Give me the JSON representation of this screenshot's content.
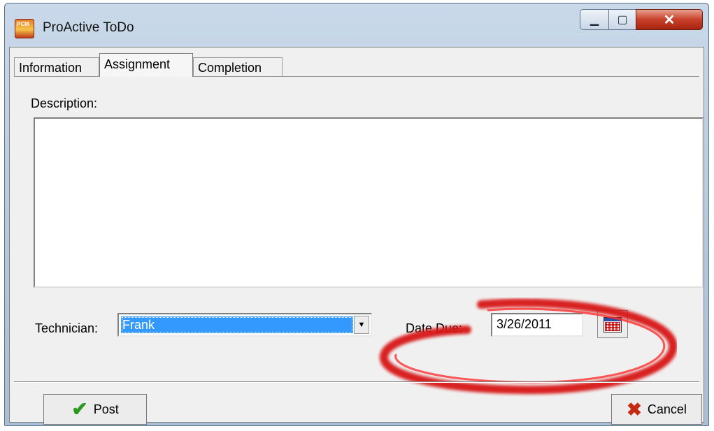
{
  "window": {
    "title": "ProActive ToDo",
    "icon": "app-icon"
  },
  "tabs": [
    {
      "label": "Information"
    },
    {
      "label": "Assignment",
      "active": true
    },
    {
      "label": "Completion"
    }
  ],
  "description": {
    "label": "Description:",
    "value": ""
  },
  "technician": {
    "label": "Technician:",
    "value": "Frank"
  },
  "due": {
    "label": "Date Due:",
    "value": "3/26/2011"
  },
  "buttons": {
    "post": "Post",
    "cancel": "Cancel"
  },
  "annotation_color": "#e01818"
}
